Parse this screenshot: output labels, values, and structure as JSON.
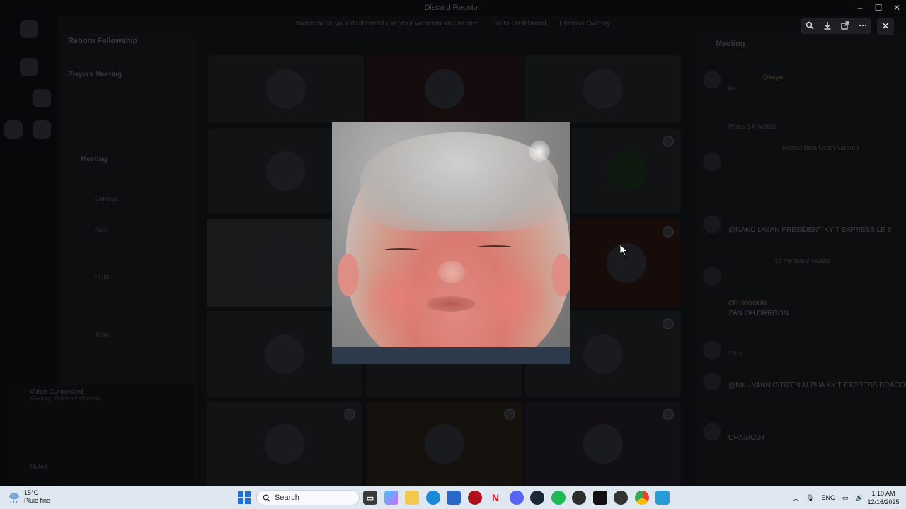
{
  "window": {
    "title": "Discord Reunion",
    "controls": [
      "–",
      "☐",
      "✕"
    ]
  },
  "banner": {
    "text": "Welcome to your dashboard use your webcam and stream",
    "link1": "Go to Dashboard",
    "link2": "Dismiss Overlay"
  },
  "server": {
    "name": "Reborn Fellowship",
    "voice_channel_1": "Players Meeting",
    "voice_channel_2": "Meeting",
    "users": [
      "Chikara",
      "Alex",
      "Fiora",
      "Tonic"
    ]
  },
  "user_panel": {
    "status": "Voice Connected",
    "channel": "Meeting / Reborn Fellowship",
    "bottom": "Muted"
  },
  "members_panel": {
    "title": "Meeting",
    "messages": [
      {
        "name": "@keyn",
        "text": "ok"
      },
      {
        "name": "",
        "text": "Wena a Kiwiflake"
      },
      {
        "name": "",
        "text": "Sophia Beta Usein Aurorea"
      },
      {
        "name": "",
        "text": "@NAKO LAYAN PRESIDENT KY T EXPRESS LE 5"
      },
      {
        "name": "",
        "text": "ce monsieur revient"
      },
      {
        "name": "CELIKOOUN",
        "text": "ZAN OH DRRGON"
      },
      {
        "name": "",
        "text": "TRO"
      },
      {
        "name": "",
        "text": "@NK - YANN CITIZEN ALPHA KY T EXPRESS DRAGON"
      },
      {
        "name": "",
        "text": "OHASIODT"
      }
    ]
  },
  "viewer": {
    "tools": [
      "zoom-icon",
      "download-icon",
      "open-external-icon",
      "more-icon"
    ],
    "close": "✕"
  },
  "preview_image": {
    "subject": "baby face gif"
  },
  "taskbar": {
    "weather_temp": "15°C",
    "weather_desc": "Pluie fine",
    "search_placeholder": "Search",
    "language": "ENG",
    "time": "1:10 AM",
    "date": "12/16/2025"
  },
  "colors": {
    "accent": "#5865F2",
    "taskbar": "#dfe7f1"
  }
}
